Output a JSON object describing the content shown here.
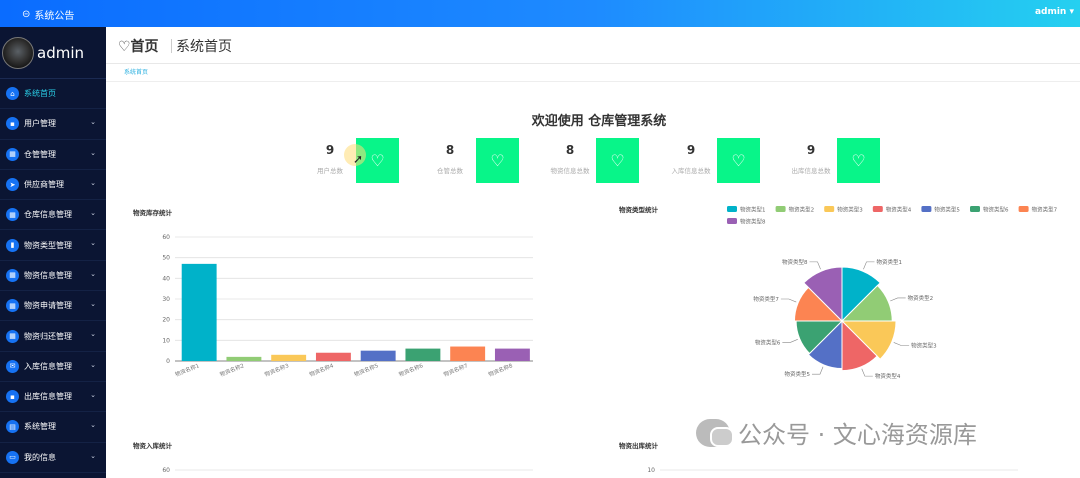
{
  "topbar": {
    "notice": "系统公告",
    "user": "admin ▾"
  },
  "sidebar": {
    "profile_name": "admin",
    "items": [
      {
        "label": "系统首页",
        "icon": "home-icon",
        "glyph": "⌂"
      },
      {
        "label": "用户管理",
        "icon": "chat-icon",
        "glyph": "▪"
      },
      {
        "label": "仓管管理",
        "icon": "grid-icon",
        "glyph": "▦"
      },
      {
        "label": "供应商管理",
        "icon": "send-icon",
        "glyph": "➤"
      },
      {
        "label": "仓库信息管理",
        "icon": "grid-icon",
        "glyph": "▦"
      },
      {
        "label": "物资类型管理",
        "icon": "book-icon",
        "glyph": "▮"
      },
      {
        "label": "物资信息管理",
        "icon": "grid-icon",
        "glyph": "▦"
      },
      {
        "label": "物资申请管理",
        "icon": "grid-icon",
        "glyph": "▦"
      },
      {
        "label": "物资归还管理",
        "icon": "grid-icon",
        "glyph": "▦"
      },
      {
        "label": "入库信息管理",
        "icon": "mail-icon",
        "glyph": "✉"
      },
      {
        "label": "出库信息管理",
        "icon": "chat-icon",
        "glyph": "▪"
      },
      {
        "label": "系统管理",
        "icon": "list-icon",
        "glyph": "▤"
      },
      {
        "label": "我的信息",
        "icon": "card-icon",
        "glyph": "▭"
      }
    ]
  },
  "header": {
    "home": "♡首页",
    "title": "系统首页"
  },
  "tags": {
    "current": "系统首页"
  },
  "welcome": "欢迎使用 仓库管理系统",
  "stats": [
    {
      "value": "9",
      "label": "用户总数"
    },
    {
      "value": "8",
      "label": "仓管总数"
    },
    {
      "value": "8",
      "label": "物资信息总数"
    },
    {
      "value": "9",
      "label": "入库信息总数"
    },
    {
      "value": "9",
      "label": "出库信息总数"
    }
  ],
  "accent_color": "#08f589",
  "chart_titles": {
    "bar": "物资库存统计",
    "pie": "物资类型统计",
    "in": "物资入库统计",
    "out": "物资出库统计"
  },
  "watermark": "公众号 · 文心海资源库",
  "chart_data": [
    {
      "type": "bar",
      "title": "物资库存统计",
      "categories": [
        "物资名称1",
        "物资名称2",
        "物资名称3",
        "物资名称4",
        "物资名称5",
        "物资名称6",
        "物资名称7",
        "物资名称8"
      ],
      "values": [
        47,
        2,
        3,
        4,
        5,
        6,
        7,
        6
      ],
      "colors": [
        "#00b2c9",
        "#91cc75",
        "#fac858",
        "#ee6666",
        "#5470c6",
        "#3ba272",
        "#fc8452",
        "#9a60b4"
      ],
      "ylim": [
        0,
        60
      ],
      "yticks": [
        0,
        10,
        20,
        30,
        40,
        50,
        60
      ]
    },
    {
      "type": "pie",
      "title": "物资类型统计",
      "legend": [
        "物资类型1",
        "物资类型2",
        "物资类型3",
        "物资类型4",
        "物资类型5",
        "物资类型6",
        "物资类型7",
        "物资类型8"
      ],
      "values": [
        1,
        1,
        1,
        1,
        1,
        1,
        1,
        1
      ],
      "radii": [
        1,
        0.93,
        1,
        0.92,
        0.88,
        0.85,
        0.88,
        1
      ],
      "colors": [
        "#00b2c9",
        "#91cc75",
        "#fac858",
        "#ee6666",
        "#5470c6",
        "#3ba272",
        "#fc8452",
        "#9a60b4"
      ],
      "legend_position": "top"
    },
    {
      "type": "bar",
      "title": "物资入库统计",
      "ylim": [
        0,
        60
      ],
      "yticks": [
        60
      ]
    },
    {
      "type": "bar",
      "title": "物资出库统计",
      "ylim": [
        0,
        10
      ],
      "yticks": [
        10
      ]
    }
  ]
}
